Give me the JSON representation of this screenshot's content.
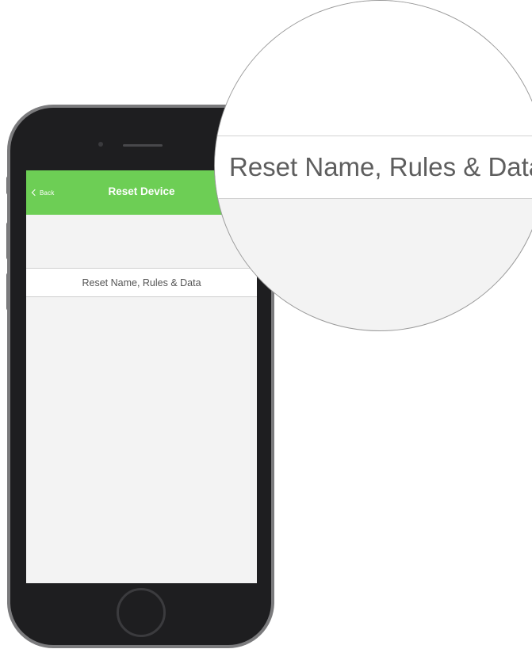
{
  "navigation": {
    "back_label": "Back",
    "title": "Reset Device"
  },
  "list": {
    "reset_item_label": "Reset Name, Rules & Data"
  },
  "magnifier": {
    "zoomed_label": "Reset Name, Rules & Data"
  },
  "colors": {
    "nav_green": "#6dce55",
    "phone_body": "#1e1e20",
    "screen_background": "#f3f3f3",
    "row_text": "#545454"
  },
  "icons": {
    "back": "chevron-left-icon"
  }
}
